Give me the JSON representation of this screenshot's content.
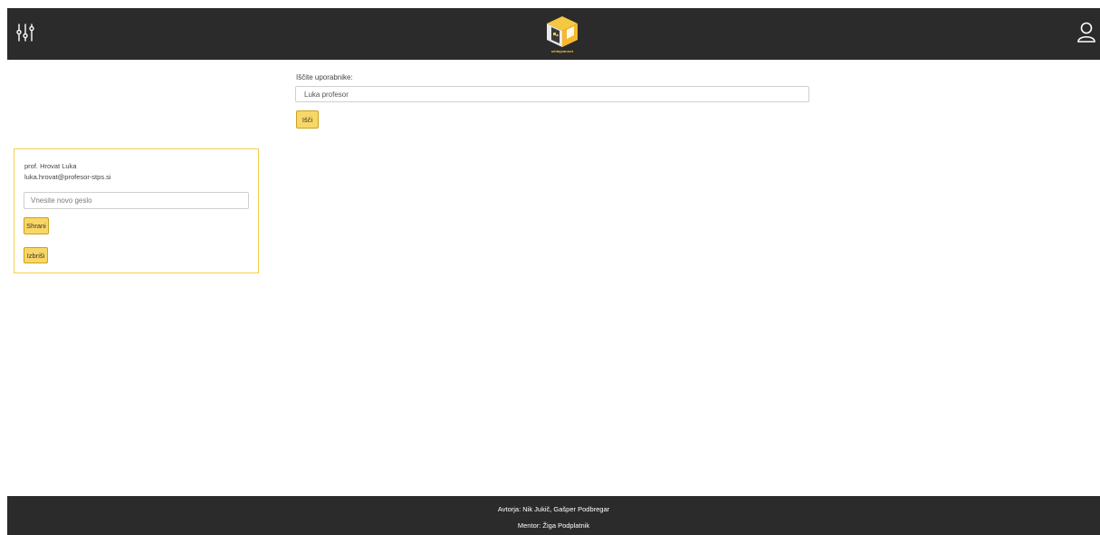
{
  "header": {
    "logo_text": "sčitajvanost",
    "settings_icon": "sliders-icon",
    "user_icon": "user-icon"
  },
  "search": {
    "label": "Iščite uporabnike:",
    "value": "Luka profesor",
    "button_label": "Išči"
  },
  "user_card": {
    "name": "prof. Hrovat Luka",
    "email": "luka.hrovat@profesor-stps.si",
    "password_placeholder": "Vnesite novo geslo",
    "save_label": "Shrani",
    "delete_label": "Izbriši"
  },
  "footer": {
    "authors": "Avtorja: Nik Jukič, Gašper Podbregar",
    "mentor": "Mentor: Žiga Podplatnik"
  },
  "colors": {
    "header_bg": "#2b2b2b",
    "accent": "#f9d766",
    "card_border": "#f4cf4d"
  }
}
